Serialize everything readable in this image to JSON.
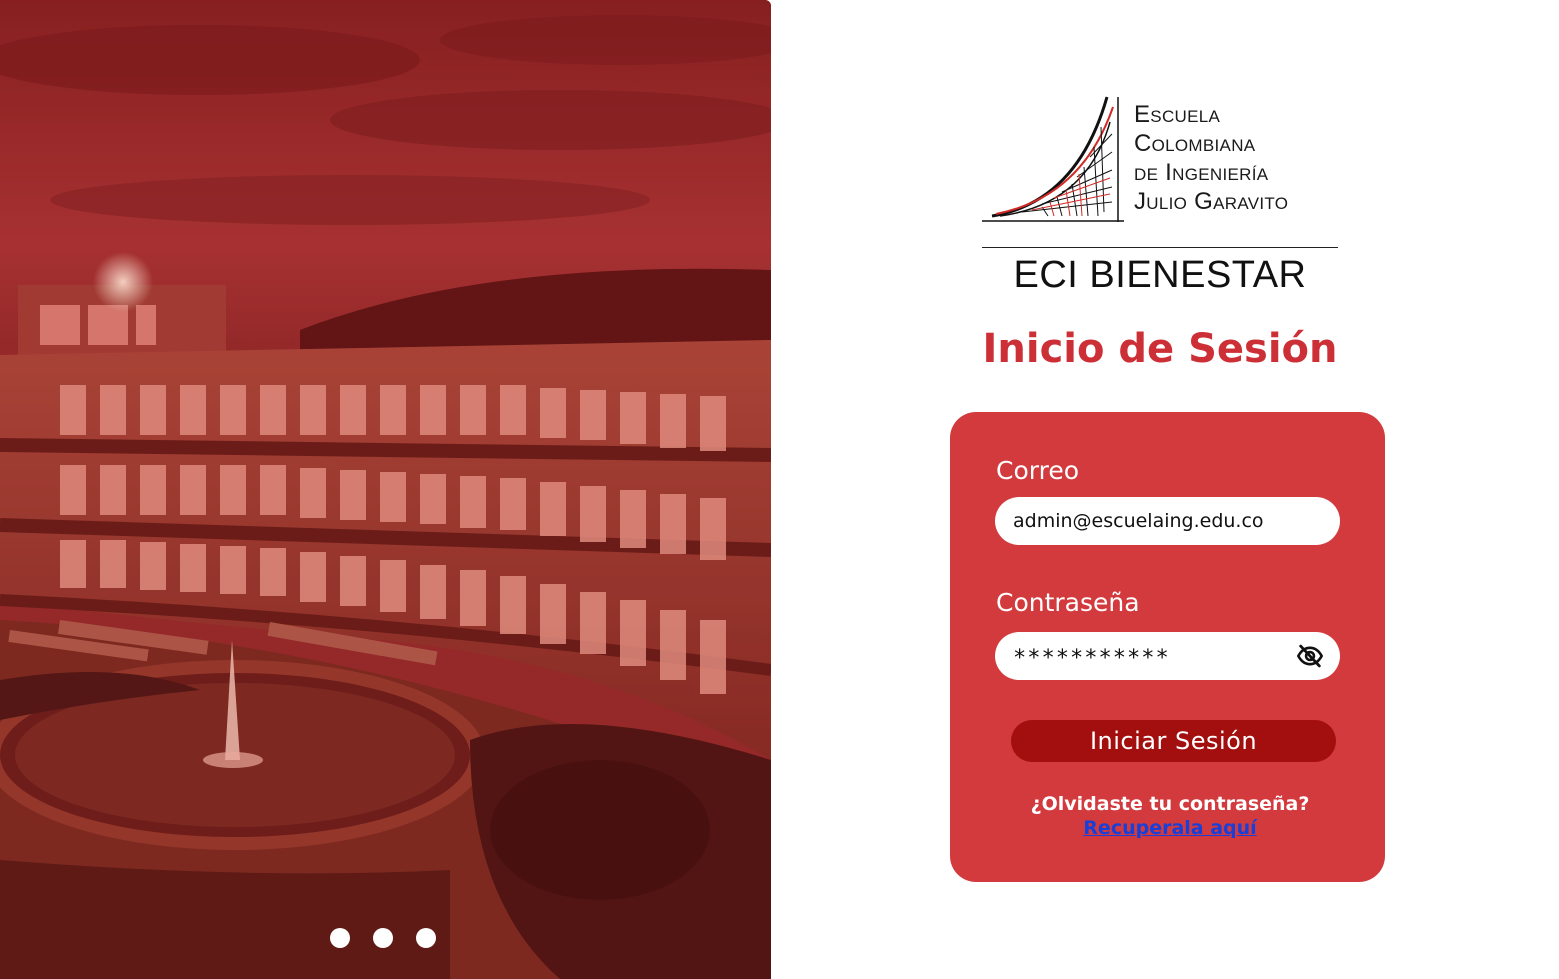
{
  "logo": {
    "lines": [
      "Escuela",
      "Colombiana",
      "de Ingeniería",
      "Julio Garavito"
    ]
  },
  "app_name": "ECI BIENESTAR",
  "title": "Inicio de Sesión",
  "form": {
    "email_label": "Correo",
    "email_value": "admin@escuelaing.edu.co",
    "password_label": "Contraseña",
    "password_value": "***********",
    "submit_label": "Iniciar Sesión",
    "forgot_text": "¿Olvidaste tu contraseña?",
    "recover_link": "Recuperala aquí"
  },
  "carousel": {
    "dots": 3
  },
  "colors": {
    "accent": "#cc2f35",
    "card": "#d33a3e",
    "button": "#a30e0e",
    "link": "#1840d8"
  },
  "icons": {
    "password_toggle": "eye-off-icon"
  }
}
